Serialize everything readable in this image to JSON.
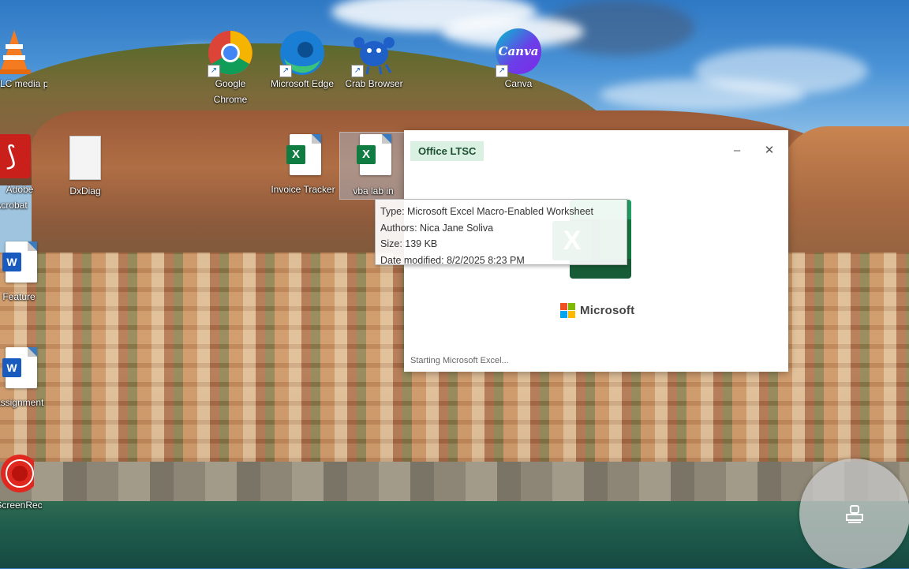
{
  "desktop": {
    "icons": [
      {
        "label": "VLC media player",
        "icon": "vlc-cone-icon"
      },
      {
        "label": "Google Chrome",
        "icon": "chrome-icon"
      },
      {
        "label": "Microsoft Edge",
        "icon": "edge-icon"
      },
      {
        "label": "Crab Browser",
        "icon": "crab-browser-icon"
      },
      {
        "label": "Canva",
        "icon": "canva-icon",
        "text": "Canva"
      },
      {
        "label": "Adobe Acrobat",
        "icon": "acrobat-icon"
      },
      {
        "label": "DxDiag",
        "icon": "text-file-icon"
      },
      {
        "label": "Invoice Tracker",
        "icon": "excel-macro-file-icon"
      },
      {
        "label": "vba lab in",
        "icon": "excel-macro-file-icon"
      },
      {
        "label": "Feature",
        "icon": "word-file-icon"
      },
      {
        "label": "Assignment",
        "icon": "word-file-icon"
      },
      {
        "label": "ScreenRec",
        "icon": "screenrec-icon"
      }
    ]
  },
  "tooltip": {
    "type": "Type: Microsoft Excel Macro-Enabled Worksheet",
    "authors": "Authors: Nica Jane Soliva",
    "size": "Size: 139 KB",
    "modified": "Date modified: 8/2/2025 8:23 PM"
  },
  "splash": {
    "title": "Office LTSC",
    "minimize": "–",
    "close": "✕",
    "logo_letter": "X",
    "brand": "Microsoft",
    "status": "Starting Microsoft Excel..."
  },
  "colors": {
    "excel_green": "#107c41",
    "word_blue": "#185abd",
    "title_chip_bg": "#d9f0e2"
  },
  "floating_button": {
    "icon": "clipboard-stamp-icon"
  }
}
